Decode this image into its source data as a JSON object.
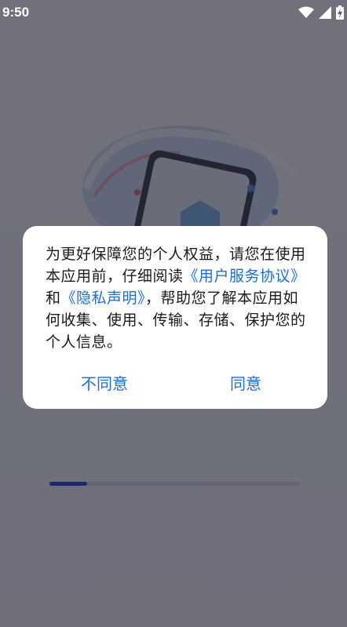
{
  "status_bar": {
    "time": "9:50",
    "icons": [
      "wifi-icon",
      "cellular-signal-icon",
      "battery-charging-icon"
    ]
  },
  "splash": {
    "progress_fraction": 0.15,
    "progress_color": "#2a46c4"
  },
  "dialog": {
    "text_segments": [
      "为更好保障您的个人权益，请您在使用本应用前，仔细阅读",
      "《用户服务协议》",
      "和",
      "《隐私声明》",
      "，帮助您了解本应用如何收集、使用、传输、存储、保护您的个人信息。"
    ],
    "link_color": "#1a6fe0",
    "disagree_label": "不同意",
    "agree_label": "同意"
  }
}
